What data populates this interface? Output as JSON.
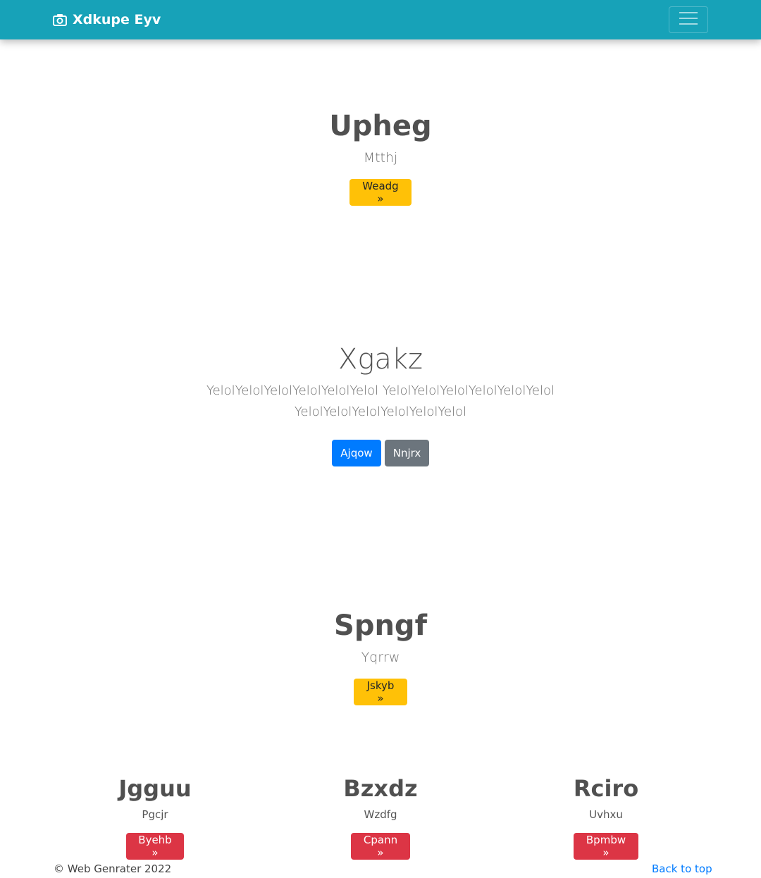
{
  "navbar": {
    "brand": "Xdkupe Eyv",
    "brand_icon": "camera-icon",
    "toggler_icon": "hamburger-menu-icon",
    "bg_color": "#17a2b8"
  },
  "hero1": {
    "title": "Upheg",
    "subtitle": "Mtthj",
    "button": "Weadg »"
  },
  "hero2": {
    "title": "Xgakz",
    "text_line1": "YelolYelolYelolYelolYelolYelol YelolYelolYelolYelolYelolYelol",
    "text_line2": "YelolYelolYelolYelolYelolYelol",
    "button_primary": "Ajqow",
    "button_secondary": "Nnjrx"
  },
  "hero3": {
    "title": "Spngf",
    "subtitle": "Yqrrw",
    "button": "Jskyb »"
  },
  "columns": [
    {
      "title": "Jgguu",
      "subtitle": "Pgcjr",
      "button": "Byehb »"
    },
    {
      "title": "Bzxdz",
      "subtitle": "Wzdfg",
      "button": "Cpann »"
    },
    {
      "title": "Rciro",
      "subtitle": "Uvhxu",
      "button": "Bpmbw »"
    }
  ],
  "footer": {
    "copyright": "© Web Genrater 2022",
    "back_to_top": "Back to top"
  },
  "colors": {
    "warning": "#ffc107",
    "primary": "#007bff",
    "secondary": "#6c757d",
    "danger": "#dc3545"
  }
}
